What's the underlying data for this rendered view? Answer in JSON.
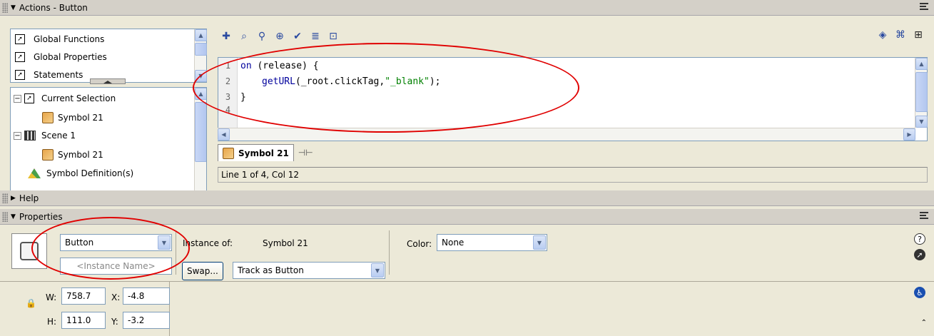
{
  "actions_panel": {
    "title": "Actions - Button",
    "toolbox_top_items": [
      "Global Functions",
      "Global Properties",
      "Statements"
    ],
    "tree": {
      "current_selection": "Current Selection",
      "symbol_a": "Symbol 21",
      "scene": "Scene 1",
      "symbol_b": "Symbol 21",
      "symbol_definitions": "Symbol Definition(s)"
    },
    "toolbar_icons": [
      "add-icon",
      "find-icon",
      "replace-icon",
      "target-icon",
      "check-syntax-icon",
      "auto-format-icon",
      "code-hint-icon"
    ],
    "toolbar_right_icons": [
      "debug-icon",
      "script-assist-icon",
      "menu-icon"
    ],
    "code": {
      "line_numbers": [
        "1",
        "2",
        "3",
        "4"
      ],
      "line1_kw": "on",
      "line1_rest": " (release) {",
      "line2_fn": "getURL",
      "line2_args_a": "(_root.clickTag,",
      "line2_str": "\"_blank\"",
      "line2_end": ");",
      "line3": "}"
    },
    "tab_label": "Symbol 21",
    "status": "Line 1 of 4, Col 12"
  },
  "help_panel": {
    "title": "Help"
  },
  "properties_panel": {
    "title": "Properties",
    "type_select": "Button",
    "instance_name_placeholder": "<Instance Name>",
    "instance_of_label": "Instance of:",
    "instance_of_value": "Symbol 21",
    "swap_label": "Swap...",
    "track_select": "Track as Button",
    "color_label": "Color:",
    "color_select": "None",
    "w_label": "W:",
    "w_value": "758.7",
    "x_label": "X:",
    "x_value": "-4.8",
    "h_label": "H:",
    "h_value": "111.0",
    "y_label": "Y:",
    "y_value": "-3.2"
  },
  "accent_colors": {
    "annotation_red": "#e00000",
    "code_keyword": "#00009c",
    "code_string": "#008000"
  }
}
